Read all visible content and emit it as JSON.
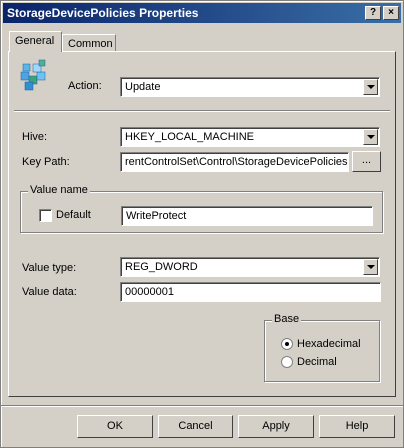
{
  "window": {
    "title": "StorageDevicePolicies Properties",
    "help_glyph": "?",
    "close_glyph": "×"
  },
  "tabs": [
    {
      "label": "General"
    },
    {
      "label": "Common"
    }
  ],
  "action": {
    "label": "Action:",
    "value": "Update"
  },
  "hive": {
    "label": "Hive:",
    "value": "HKEY_LOCAL_MACHINE"
  },
  "key_path": {
    "label": "Key Path:",
    "value": "rentControlSet\\Control\\StorageDevicePolicies",
    "browse_label": "..."
  },
  "value_name": {
    "group_title": "Value name",
    "default_label": "Default",
    "default_checked": false,
    "value": "WriteProtect"
  },
  "value_type": {
    "label": "Value type:",
    "value": "REG_DWORD"
  },
  "value_data": {
    "label": "Value data:",
    "value": "00000001"
  },
  "base": {
    "group_title": "Base",
    "options": [
      {
        "label": "Hexadecimal",
        "selected": true
      },
      {
        "label": "Decimal",
        "selected": false
      }
    ]
  },
  "buttons": {
    "ok": "OK",
    "cancel": "Cancel",
    "apply": "Apply",
    "help": "Help"
  },
  "icons": {
    "registry": "registry-cubes-icon"
  },
  "colors": {
    "title_start": "#0a246a",
    "title_end": "#3a6ea5",
    "face": "#d4d0c8"
  }
}
